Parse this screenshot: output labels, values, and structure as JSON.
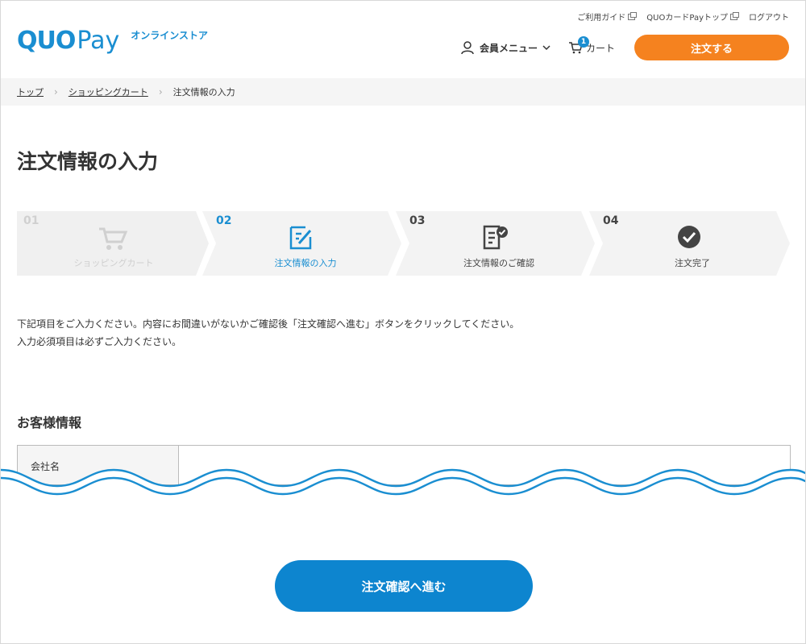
{
  "header": {
    "utility_links": [
      "ご利用ガイド",
      "QUOカードPayトップ",
      "ログアウト"
    ],
    "logo_text_bold": "QUO",
    "logo_text_light": "Pay",
    "logo_store": "オンラインストア",
    "member_menu": "会員メニュー",
    "cart_label": "カート",
    "cart_count": "1",
    "order_button": "注文する"
  },
  "breadcrumb": {
    "items": [
      "トップ",
      "ショッピングカート",
      "注文情報の入力"
    ]
  },
  "page_title": "注文情報の入力",
  "steps": [
    {
      "num": "01",
      "label": "ショッピングカート",
      "state": "done",
      "icon": "cart-icon"
    },
    {
      "num": "02",
      "label": "注文情報の入力",
      "state": "current",
      "icon": "edit-form-icon"
    },
    {
      "num": "03",
      "label": "注文情報のご確認",
      "state": "upcoming",
      "icon": "document-check-icon"
    },
    {
      "num": "04",
      "label": "注文完了",
      "state": "upcoming",
      "icon": "check-circle-icon"
    }
  ],
  "intro": {
    "line1": "下記項目をご入力ください。内容にお間違いがないかご確認後「注文確認へ進む」ボタンをクリックしてください。",
    "line2": "入力必須項目は必ずご入力ください。"
  },
  "customer_section": {
    "title": "お客様情報",
    "fields": [
      {
        "label": "会社名",
        "value": ""
      }
    ]
  },
  "submit_button": "注文確認へ進む",
  "colors": {
    "brand_blue": "#1a8ed1",
    "order_orange": "#f5821f",
    "submit_blue": "#0d85cf",
    "step_done_bg": "#f0f0f0",
    "step_bg": "#f3f3f3"
  }
}
